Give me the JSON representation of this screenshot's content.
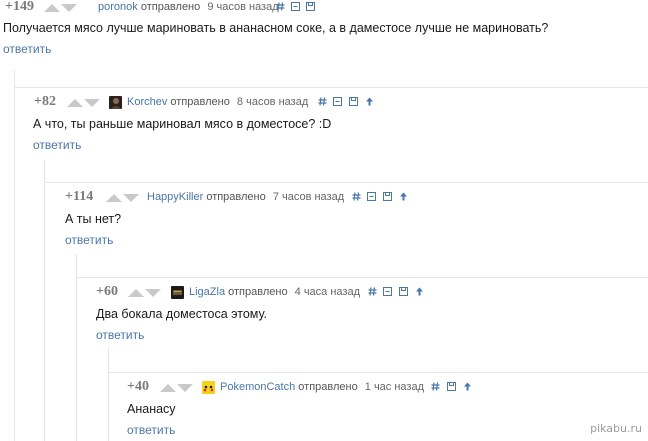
{
  "comments": [
    {
      "score": "+149",
      "user": "poronok",
      "action": "отправлено",
      "time": "9 часов назад",
      "text": "Получается мясо лучше мариновать в ананасном соке, а в даместосе лучше не мариновать?",
      "reply": "ответить"
    },
    {
      "score": "+82",
      "user": "Korchev",
      "action": "отправлено",
      "time": "8 часов назад",
      "text": "А что, ты раньше мариновал мясо в доместосе? :D",
      "reply": "ответить"
    },
    {
      "score": "+114",
      "user": "HappyKiller",
      "action": "отправлено",
      "time": "7 часов назад",
      "text": "А ты нет?",
      "reply": "ответить"
    },
    {
      "score": "+60",
      "user": "LigaZla",
      "action": "отправлено",
      "time": "4 часа назад",
      "text": "Два бокала доместоса этому.",
      "reply": "ответить"
    },
    {
      "score": "+40",
      "user": "PokemonCatch",
      "action": "отправлено",
      "time": "1 час назад",
      "text": "Ананасу",
      "reply": "ответить"
    }
  ],
  "icons": {
    "link": "hash-icon",
    "collapse": "collapse-icon",
    "save": "save-icon",
    "parent": "arrow-up-icon"
  },
  "watermark": "pikabu.ru",
  "colors": {
    "username": "#4a76a8",
    "score": "#7a7a7a",
    "vote_arrow": "#c9c9c9",
    "reply": "#4a76a8"
  }
}
